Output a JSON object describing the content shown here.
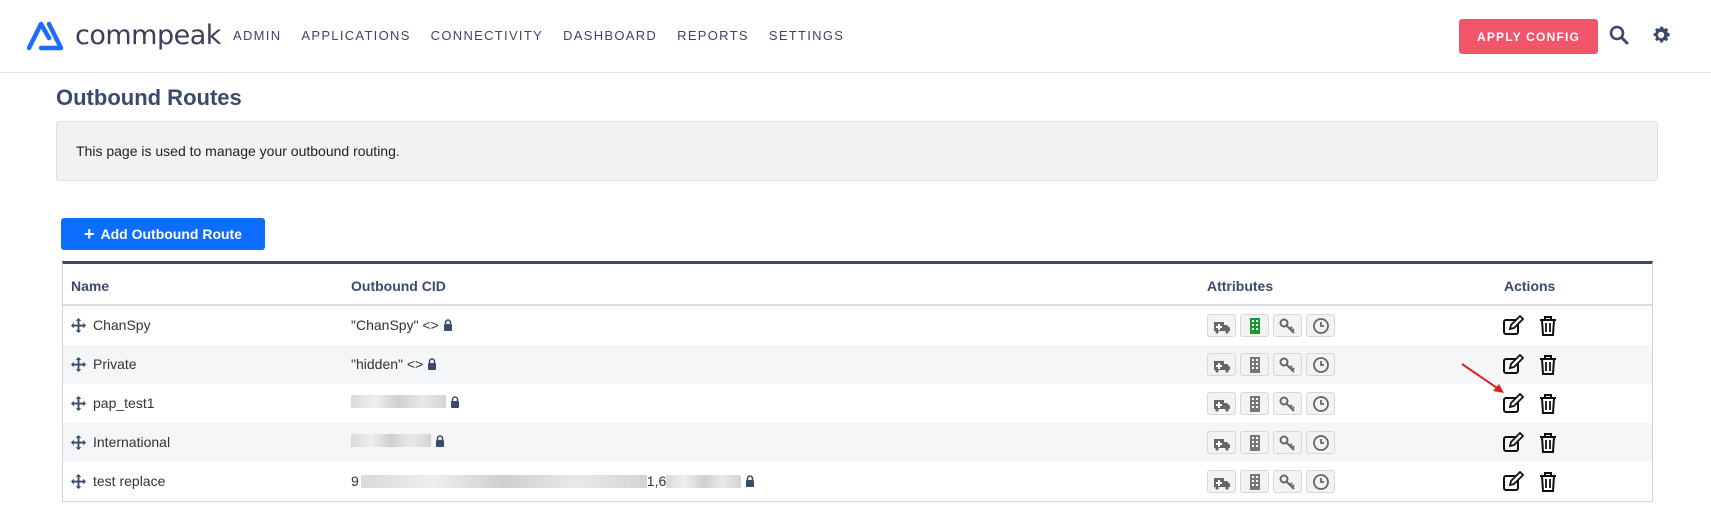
{
  "header": {
    "brand": "commpeak",
    "nav": [
      "ADMIN",
      "APPLICATIONS",
      "CONNECTIVITY",
      "DASHBOARD",
      "REPORTS",
      "SETTINGS"
    ],
    "apply_label": "APPLY CONFIG",
    "icons": [
      "search-icon",
      "gear-icon"
    ],
    "accent_color": "#f25469",
    "brand_color": "#1e6cff"
  },
  "page": {
    "title": "Outbound Routes",
    "info": "This page is used to manage your outbound routing.",
    "add_label": "Add Outbound Route"
  },
  "table": {
    "columns": [
      "Name",
      "Outbound CID",
      "Attributes",
      "Actions"
    ],
    "rows": [
      {
        "name": "ChanSpy",
        "cid": "\"ChanSpy\" <>",
        "cid_redacted": false,
        "building_active": true
      },
      {
        "name": "Private",
        "cid": "\"hidden\" <>",
        "cid_redacted": false,
        "building_active": false
      },
      {
        "name": "pap_test1",
        "cid": "",
        "cid_redacted": true,
        "building_active": false
      },
      {
        "name": "International",
        "cid": "",
        "cid_redacted": true,
        "building_active": false
      },
      {
        "name": "test replace",
        "cid_prefix": "9",
        "cid_mid": "1,6",
        "cid_redacted": true,
        "building_active": false
      }
    ],
    "attribute_icons": [
      "ambulance-icon",
      "building-icon",
      "key-icon",
      "clock-icon"
    ],
    "action_icons": [
      "edit-icon",
      "trash-icon"
    ]
  }
}
